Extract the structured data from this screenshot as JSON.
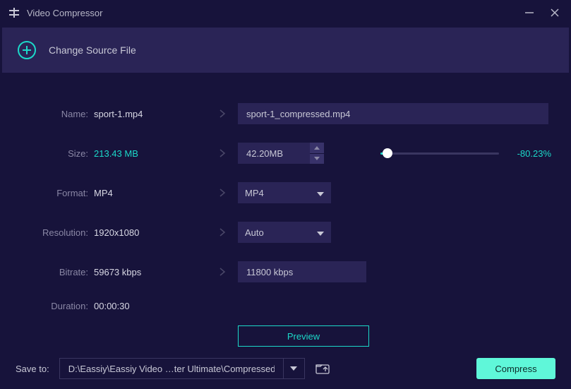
{
  "app": {
    "title": "Video Compressor"
  },
  "header": {
    "change_source": "Change Source File"
  },
  "labels": {
    "name": "Name:",
    "size": "Size:",
    "format": "Format:",
    "resolution": "Resolution:",
    "bitrate": "Bitrate:",
    "duration": "Duration:"
  },
  "source": {
    "name": "sport-1.mp4",
    "size": "213.43 MB",
    "format": "MP4",
    "resolution": "1920x1080",
    "bitrate": "59673 kbps",
    "duration": "00:00:30"
  },
  "target": {
    "name": "sport-1_compressed.mp4",
    "size": "42.20MB",
    "format": "MP4",
    "resolution": "Auto",
    "bitrate": "11800 kbps",
    "size_change_pct": "-80.23%"
  },
  "buttons": {
    "preview": "Preview",
    "compress": "Compress"
  },
  "footer": {
    "save_to_label": "Save to:",
    "path": "D:\\Eassiy\\Eassiy Video …ter Ultimate\\Compressed"
  }
}
